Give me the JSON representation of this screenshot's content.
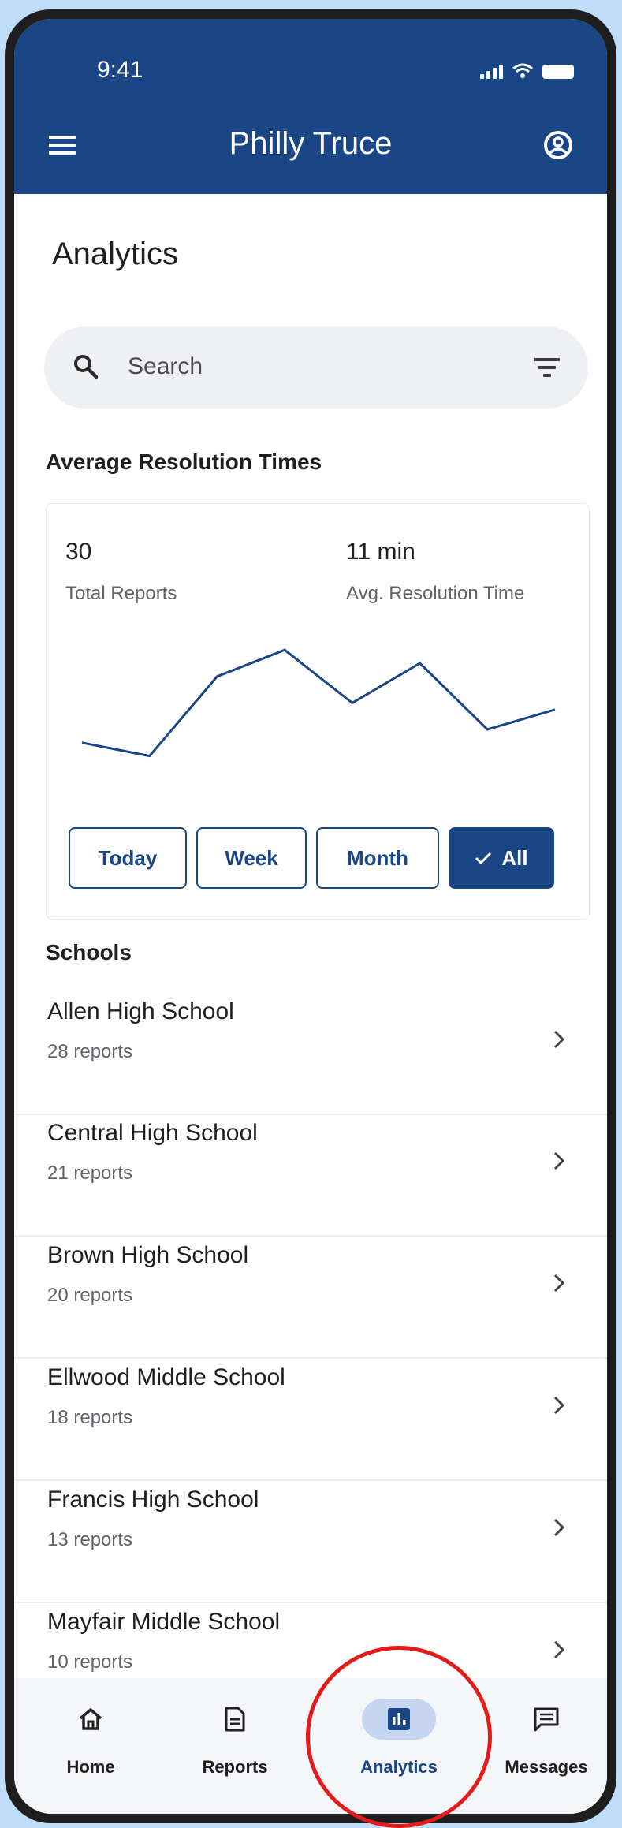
{
  "status_bar": {
    "time": "9:41"
  },
  "app_bar": {
    "title": "Philly Truce",
    "menu_icon": "menu-icon",
    "account_icon": "account-circle-icon"
  },
  "page": {
    "title": "Analytics"
  },
  "search": {
    "placeholder": "Search"
  },
  "resolution_section": {
    "title": "Average Resolution Times",
    "total_reports_value": "30",
    "total_reports_label": "Total Reports",
    "avg_time_value": "11 min",
    "avg_time_label": "Avg. Resolution Time",
    "range_buttons": [
      "Today",
      "Week",
      "Month",
      "All"
    ],
    "selected_range": "All"
  },
  "chart_data": {
    "type": "line",
    "title": "",
    "xlabel": "",
    "ylabel": "",
    "x": [
      1,
      2,
      3,
      4,
      5,
      6,
      7,
      8
    ],
    "series": [
      {
        "values": [
          8,
          6,
          18,
          22,
          14,
          20,
          10,
          13
        ]
      }
    ],
    "ylim": [
      0,
      25
    ],
    "grid": false,
    "color": "#1a4686"
  },
  "schools": {
    "title": "Schools",
    "items": [
      {
        "name": "Allen High School",
        "count": "28 reports"
      },
      {
        "name": "Central High School",
        "count": "21 reports"
      },
      {
        "name": "Brown High School",
        "count": "20 reports"
      },
      {
        "name": "Ellwood Middle School",
        "count": "18 reports"
      },
      {
        "name": "Francis High School",
        "count": "13 reports"
      },
      {
        "name": "Mayfair Middle School",
        "count": "10 reports"
      }
    ]
  },
  "bottom_nav": {
    "items": [
      {
        "label": "Home",
        "icon": "home-icon"
      },
      {
        "label": "Reports",
        "icon": "document-icon"
      },
      {
        "label": "Analytics",
        "icon": "bar-chart-icon"
      },
      {
        "label": "Messages",
        "icon": "chat-icon"
      }
    ],
    "active": "Analytics"
  },
  "colors": {
    "brand": "#1a4686",
    "highlight": "#e41b1b",
    "background": "#bfdcf8"
  }
}
